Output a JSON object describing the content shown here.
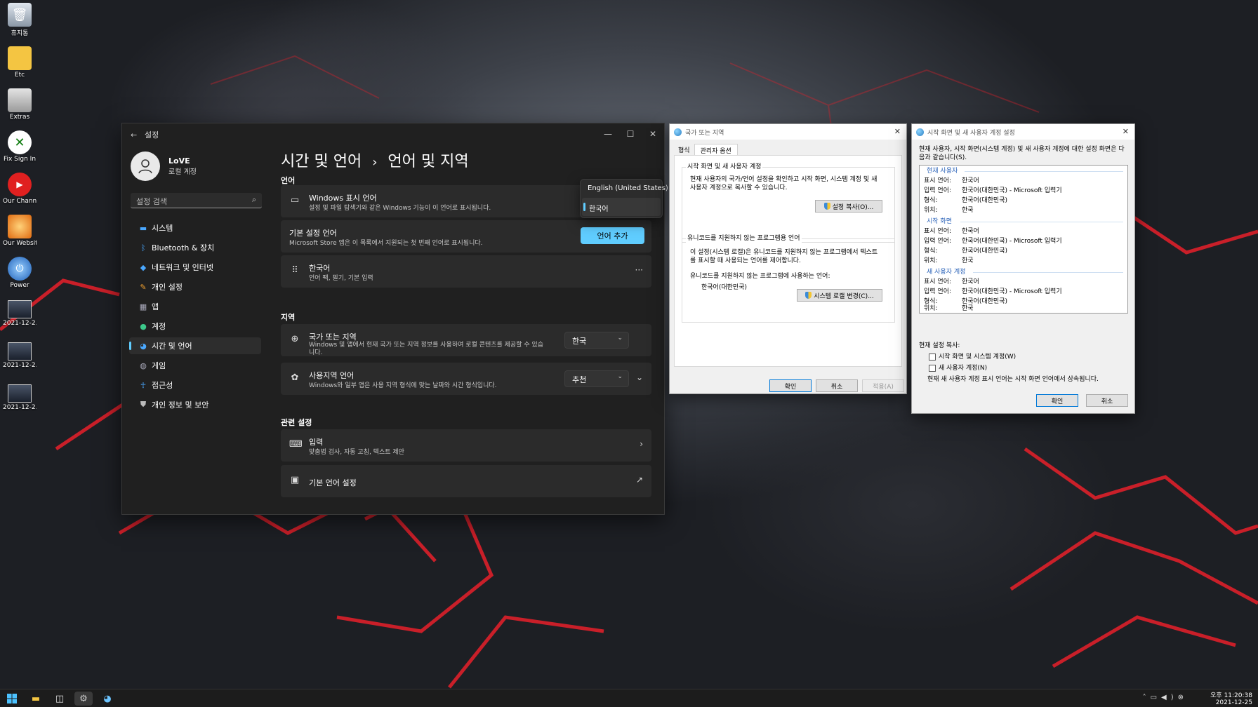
{
  "desktop": {
    "icons": [
      {
        "label": "휴지통",
        "icon": "recycle-bin-icon"
      },
      {
        "label": "Etc",
        "icon": "folder-icon"
      },
      {
        "label": "Extras",
        "icon": "extras-icon"
      },
      {
        "label": "Fix Sign In",
        "icon": "xbox-icon"
      },
      {
        "label": "Our Channel",
        "icon": "youtube-icon"
      },
      {
        "label": "Our Website",
        "icon": "website-icon"
      },
      {
        "label": "Power",
        "icon": "power-icon"
      },
      {
        "label": "2021-12-2...",
        "icon": "screenshot-icon"
      },
      {
        "label": "2021-12-2...",
        "icon": "screenshot-icon"
      },
      {
        "label": "2021-12-2...",
        "icon": "screenshot-icon"
      }
    ]
  },
  "settings": {
    "title": "설정",
    "user": {
      "name": "LoVE",
      "type": "로컬 계정"
    },
    "search_placeholder": "설정 검색",
    "nav": [
      {
        "label": "시스템",
        "icon": "system-icon"
      },
      {
        "label": "Bluetooth & 장치",
        "icon": "bluetooth-icon"
      },
      {
        "label": "네트워크 및 인터넷",
        "icon": "network-icon"
      },
      {
        "label": "개인 설정",
        "icon": "brush-icon"
      },
      {
        "label": "앱",
        "icon": "apps-icon"
      },
      {
        "label": "계정",
        "icon": "account-icon"
      },
      {
        "label": "시간 및 언어",
        "icon": "globe-clock-icon",
        "active": true
      },
      {
        "label": "게임",
        "icon": "gamepad-icon"
      },
      {
        "label": "접근성",
        "icon": "accessibility-icon"
      },
      {
        "label": "개인 정보 및 보안",
        "icon": "shield-icon"
      }
    ],
    "breadcrumb": {
      "parent": "시간 및 언어",
      "separator": "›",
      "current": "언어 및 지역"
    },
    "language_section": "언어",
    "display_language": {
      "title": "Windows 표시 언어",
      "sub": "설정 및 파일 탐색기와 같은 Windows 기능이 이 언어로 표시됩니다."
    },
    "display_language_options": [
      "English (United States)",
      "한국어"
    ],
    "display_language_selected": "한국어",
    "preferred_language": {
      "title": "기본 설정 언어",
      "sub": "Microsoft Store 앱은 이 목록에서 지원되는 첫 번째 언어로 표시됩니다.",
      "button": "언어 추가"
    },
    "korean": {
      "title": "한국어",
      "sub": "언어 팩, 필기, 기본 입력",
      "more": "···"
    },
    "region_section": "지역",
    "country": {
      "title": "국가 또는 지역",
      "sub": "Windows 및 앱에서 현재 국가 또는 지역 정보를 사용하여 로컬 콘텐츠를 제공할 수 있습니다.",
      "value": "한국"
    },
    "regional_format": {
      "title": "사용지역 언어",
      "sub": "Windows와 일부 앱은 사용 지역 형식에 맞는 날짜와 시간 형식입니다.",
      "value": "추천"
    },
    "related_section": "관련 설정",
    "typing": {
      "title": "입력",
      "sub": "맞춤법 검사, 자동 고침, 텍스트 제안"
    },
    "admin_language": {
      "title": "기본 언어 설정"
    }
  },
  "region_dialog": {
    "title": "국가 또는 지역",
    "tabs": [
      "형식",
      "관리자 옵션"
    ],
    "group1_title": "시작 화면 및 새 사용자 계정",
    "group1_text": [
      "현재 사용자의 국가/언어 설정을 확인하고 시작 화면, 시스템 계정 및 새",
      "사용자 계정으로 복사할 수 있습니다."
    ],
    "copy_button": "설정 복사(O)...",
    "group2_title": "유니코드를 지원하지 않는 프로그램용 언어",
    "group2_text": [
      "이 설정(시스템 로캘)은 유니코드를 지원하지 않는 프로그램에서 텍스트",
      "를 표시할 때 사용되는 언어를 제어합니다."
    ],
    "current_label": "유니코드를 지원하지 않는 프로그램에 사용하는 언어:",
    "current_value": "한국어(대한민국)",
    "change_button": "시스템 로캘 변경(C)...",
    "ok": "확인",
    "cancel": "취소",
    "apply": "적용(A)"
  },
  "welcome_dialog": {
    "title": "시작 화면 및 새 사용자 계정 설정",
    "intro": [
      "현재 사용자, 시작 화면(시스템 계정) 및 새 사용자 계정에 대한 설정 화면은 다",
      "음과 같습니다(S)."
    ],
    "labels": {
      "display": "표시 언어:",
      "input": "입력 언어:",
      "format": "형식:",
      "location": "위치:"
    },
    "sections": [
      {
        "name": "현재 사용자",
        "display": "한국어",
        "input": "한국어(대한민국) - Microsoft 입력기",
        "format": "한국어(대한민국)",
        "location": "한국"
      },
      {
        "name": "시작 화면",
        "display": "한국어",
        "input": "한국어(대한민국) - Microsoft 입력기",
        "format": "한국어(대한민국)",
        "location": "한국"
      },
      {
        "name": "새 사용자 계정",
        "display": "한국어",
        "input": "한국어(대한민국) - Microsoft 입력기",
        "format": "한국어(대한민국)",
        "location": "한국"
      }
    ],
    "copy_heading": "현재 설정 복사:",
    "check1": "시작 화면 및 시스템 계정(W)",
    "check2": "새 사용자 계정(N)",
    "note": "현재 새 사용자 계정 표시 언어는 시작 화면 언어에서 상속됩니다.",
    "ok": "확인",
    "cancel": "취소"
  },
  "taskbar": {
    "time": "오후 11:20:38",
    "date": "2021-12-25"
  },
  "colors": {
    "accent": "#60cdff",
    "wallpaper_glow": "#e8202a",
    "settings_bg": "#202020"
  }
}
